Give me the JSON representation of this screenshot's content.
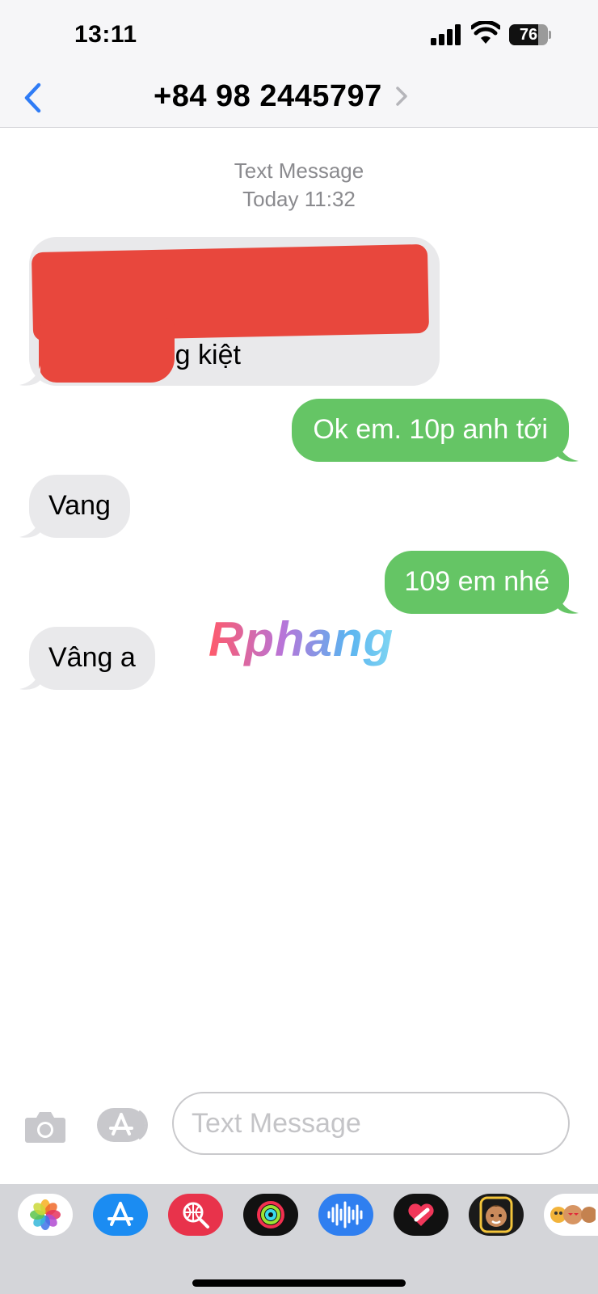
{
  "status_bar": {
    "time": "13:11",
    "battery_level": "76",
    "battery_fraction": 0.76
  },
  "header": {
    "contact": "+84 98 2445797",
    "back_icon": "chevron-left-icon",
    "detail_icon": "chevron-right-icon"
  },
  "thread": {
    "service_label": "Text Message",
    "timestamp": "Today 11:32",
    "messages": [
      {
        "direction": "incoming",
        "text": "g lý thương kiệt",
        "redacted": true
      },
      {
        "direction": "outgoing",
        "text": "Ok em. 10p anh tới"
      },
      {
        "direction": "incoming",
        "text": "Vang"
      },
      {
        "direction": "outgoing",
        "text": "109 em nhé"
      },
      {
        "direction": "incoming",
        "text": "Vâng a"
      }
    ]
  },
  "watermark": "Rphang",
  "compose": {
    "placeholder": "Text Message",
    "value": "",
    "camera_icon": "camera-icon",
    "apps_icon": "app-store-icon"
  },
  "app_drawer": {
    "apps": [
      {
        "name": "photos-app-icon",
        "bg": "#ffffff"
      },
      {
        "name": "app-store-app-icon",
        "bg": "#1b8cf2"
      },
      {
        "name": "images-search-app-icon",
        "bg": "#e8334b"
      },
      {
        "name": "fitness-app-icon",
        "bg": "#111111"
      },
      {
        "name": "audio-message-app-icon",
        "bg": "#2f7ff0"
      },
      {
        "name": "digital-touch-app-icon",
        "bg": "#111111"
      },
      {
        "name": "memoji-app-icon",
        "bg": "#1a1a1a"
      },
      {
        "name": "memoji-stickers-app-icon",
        "bg": "#ffffff"
      }
    ]
  },
  "colors": {
    "outgoing_bubble": "#65c565",
    "incoming_bubble": "#e9e9eb",
    "accent": "#2f7cf6",
    "redaction": "#e8473d"
  }
}
